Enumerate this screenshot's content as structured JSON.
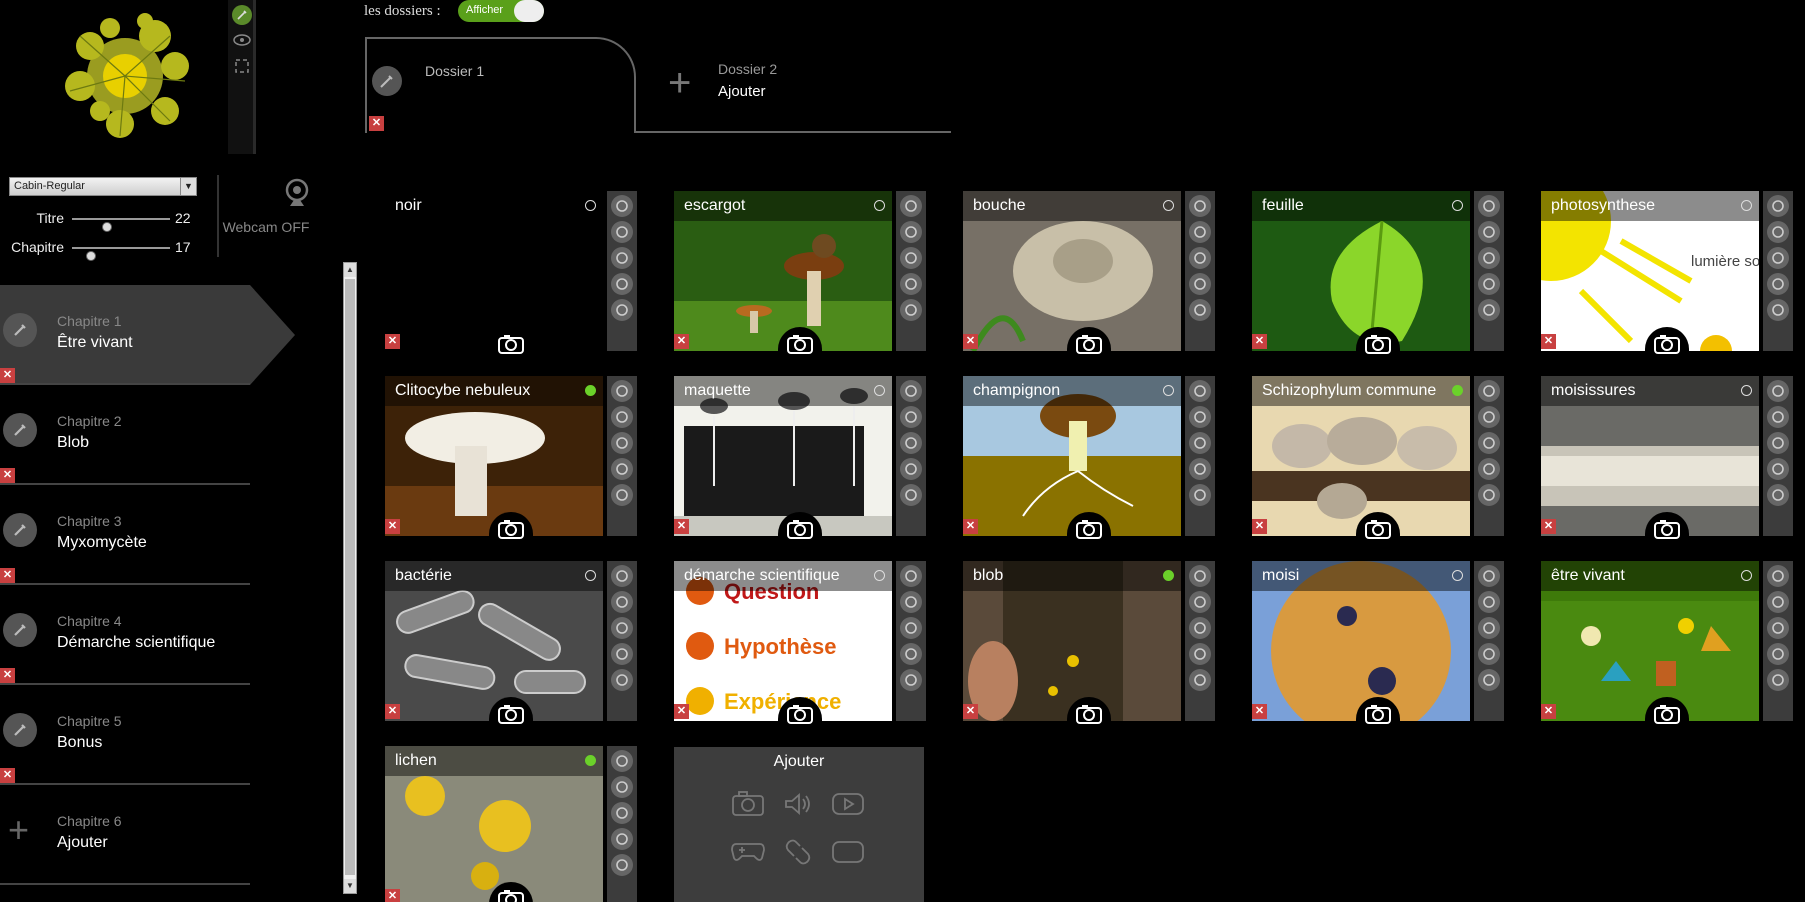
{
  "sidebar": {
    "font_select": "Cabin-Regular",
    "sliders": [
      {
        "label": "Titre",
        "value": "22",
        "level": 0.34
      },
      {
        "label": "Chapitre",
        "value": "17",
        "level": 0.16
      }
    ],
    "webcam_label": "Webcam OFF",
    "chapters": [
      {
        "num": "Chapitre 1",
        "name": "Être vivant",
        "active": true
      },
      {
        "num": "Chapitre 2",
        "name": "Blob"
      },
      {
        "num": "Chapitre 3",
        "name": "Myxomycète"
      },
      {
        "num": "Chapitre 4",
        "name": "Démarche scientifique"
      },
      {
        "num": "Chapitre 5",
        "name": "Bonus"
      },
      {
        "num": "Chapitre 6",
        "name": "Ajouter",
        "add": true
      }
    ]
  },
  "dossiers": {
    "label": "les dossiers :",
    "toggle_label": "Afficher",
    "tab1": {
      "title": "Dossier 1"
    },
    "tab2": {
      "title": "Dossier 2",
      "action": "Ajouter"
    }
  },
  "cards": [
    {
      "title": "noir",
      "status": "off",
      "scene": "black"
    },
    {
      "title": "escargot",
      "status": "off",
      "scene": "escargot"
    },
    {
      "title": "bouche",
      "status": "off",
      "scene": "bouche"
    },
    {
      "title": "feuille",
      "status": "off",
      "scene": "feuille"
    },
    {
      "title": "photosynthese",
      "status": "off",
      "scene": "photo",
      "overlay": "lumière solaire"
    },
    {
      "title": "Clitocybe nebuleux",
      "status": "on",
      "scene": "clitocybe"
    },
    {
      "title": "maquette",
      "status": "off",
      "scene": "maquette"
    },
    {
      "title": "champignon",
      "status": "off",
      "scene": "champignon"
    },
    {
      "title": "Schizophylum commune",
      "status": "on",
      "scene": "schizo"
    },
    {
      "title": "moisissures",
      "status": "off",
      "scene": "moisissures"
    },
    {
      "title": "bactérie",
      "status": "off",
      "scene": "bacterie"
    },
    {
      "title": "démarche scientifique",
      "status": "off",
      "scene": "demarche",
      "overlay": [
        "Question",
        "Hypothèse",
        "Expérience"
      ]
    },
    {
      "title": "blob",
      "status": "on",
      "scene": "blob"
    },
    {
      "title": "moisi",
      "status": "off",
      "scene": "moisi"
    },
    {
      "title": "être vivant",
      "status": "off",
      "scene": "etre"
    },
    {
      "title": "lichen",
      "status": "on",
      "scene": "lichen"
    }
  ],
  "add_card": {
    "title": "Ajouter",
    "icons": [
      "camera-icon",
      "sound-icon",
      "video-icon",
      "game-icon",
      "link-icon",
      "frame-icon"
    ]
  }
}
